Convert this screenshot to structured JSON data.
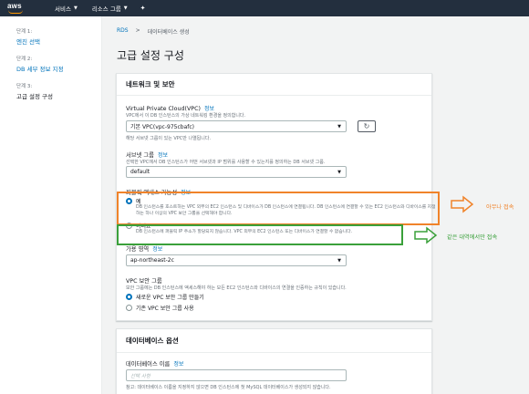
{
  "nav": {
    "logo": "aws",
    "services": "서비스",
    "resource_groups": "리소스 그룹",
    "pin_icon": "pin-icon"
  },
  "sidebar": {
    "steps": [
      {
        "num": "단계 1:",
        "label": "엔진 선택"
      },
      {
        "num": "단계 2:",
        "label": "DB 세부 정보 지정"
      },
      {
        "num": "단계 3:",
        "label": "고급 설정 구성"
      }
    ]
  },
  "breadcrumb": {
    "root": "RDS",
    "sep": ">",
    "current": "데이터베이스 생성"
  },
  "page_title": "고급 설정 구성",
  "network": {
    "title": "네트워크 및 보안",
    "vpc_label": "Virtual Private Cloud(VPC)",
    "info": "정보",
    "vpc_desc": "VPC에서 이 DB 인스턴스의 가상 네트워킹 환경을 정의합니다.",
    "vpc_value": "기본 VPC(vpc-975cbafc)",
    "vpc_note": "해당 서브넷 그룹이 있는 VPC만 나열됩니다.",
    "subnet_label": "서브넷 그룹",
    "subnet_desc": "선택한 VPC에서 DB 인스턴스가 어떤 서브넷과 IP 범위를 사용할 수 있는지를 정의하는 DB 서브넷 그룹.",
    "subnet_value": "default",
    "public_label": "퍼블릭 액세스 가능성",
    "yes_label": "예",
    "yes_desc": "DB 인스턴스를 호스트하는 VPC 외부의 EC2 인스턴스 및 디바이스가 DB 인스턴스에 연결됩니다. DB 인스턴스에 연결할 수 있는 EC2 인스턴스와 디바이스를 지정하는 하나 이상의 VPC 보안 그룹을 선택해야 합니다.",
    "no_label": "아니요",
    "no_desc": "DB 인스턴스에 퍼블릭 IP 주소가 할당되지 않습니다. VPC 외부의 EC2 인스턴스 또는 디바이스가 연결할 수 없습니다.",
    "az_label": "가용 영역",
    "az_value": "ap-northeast-2c",
    "sg_label": "VPC 보안 그룹",
    "sg_desc": "보안 그룹에는 DB 인스턴스에 액세스해야 하는 모든 EC2 인스턴스와 디바이스의 연결을 인증하는 규칙이 있습니다.",
    "sg_new": "새로운 VPC 보안 그룹 만들기",
    "sg_existing": "기존 VPC 보안 그룹 사용"
  },
  "db_options": {
    "title": "데이터베이스 옵션",
    "name_label": "데이터베이스 이름",
    "info": "정보",
    "name_placeholder": "선택 사항",
    "name_note": "참고: 데이터베이스 이름을 지정하지 않으면 DB 인스턴스에 첫 MySQL 데이터베이스가 생성되지 않습니다."
  },
  "annotations": {
    "orange_text": "아무나 접속",
    "green_text": "같은 대역에서만 접속",
    "orange_color": "#f0832a",
    "green_color": "#3aa03a"
  }
}
